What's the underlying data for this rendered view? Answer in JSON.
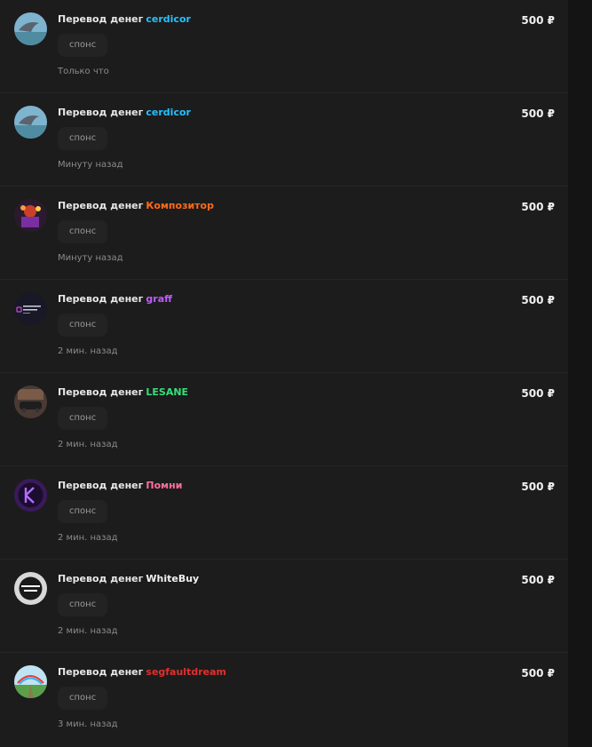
{
  "items": [
    {
      "title": "Перевод денег",
      "user": "cerdicor",
      "user_color": "#27c0ff",
      "tag": "спонс",
      "time": "Только что",
      "amount": "500 ₽",
      "avatar": "dolphin"
    },
    {
      "title": "Перевод денег",
      "user": "cerdicor",
      "user_color": "#27c0ff",
      "tag": "спонс",
      "time": "Минуту назад",
      "amount": "500 ₽",
      "avatar": "dolphin"
    },
    {
      "title": "Перевод денег",
      "user": "Композитор",
      "user_color": "#ff6a1a",
      "tag": "спонс",
      "time": "Минуту назад",
      "amount": "500 ₽",
      "avatar": "crowd"
    },
    {
      "title": "Перевод денег",
      "user": "graff",
      "user_color": "#c05cff",
      "tag": "спонс",
      "time": "2 мин. назад",
      "amount": "500 ₽",
      "avatar": "lock-logo"
    },
    {
      "title": "Перевод денег",
      "user": "LESANE",
      "user_color": "#33e07a",
      "tag": "спонс",
      "time": "2 мин. назад",
      "amount": "500 ₽",
      "avatar": "car"
    },
    {
      "title": "Перевод денег",
      "user": "Помни",
      "user_color": "#ff6f9c",
      "tag": "спонс",
      "time": "2 мин. назад",
      "amount": "500 ₽",
      "avatar": "k-logo"
    },
    {
      "title": "Перевод денег",
      "user": "WhiteBuy",
      "user_color": "#f2f2f2",
      "tag": "спонс",
      "time": "2 мин. назад",
      "amount": "500 ₽",
      "avatar": "bot-logo"
    },
    {
      "title": "Перевод денег",
      "user": "segfaultdream",
      "user_color": "#e0302e",
      "tag": "спонс",
      "time": "3 мин. назад",
      "amount": "500 ₽",
      "avatar": "landscape"
    }
  ]
}
